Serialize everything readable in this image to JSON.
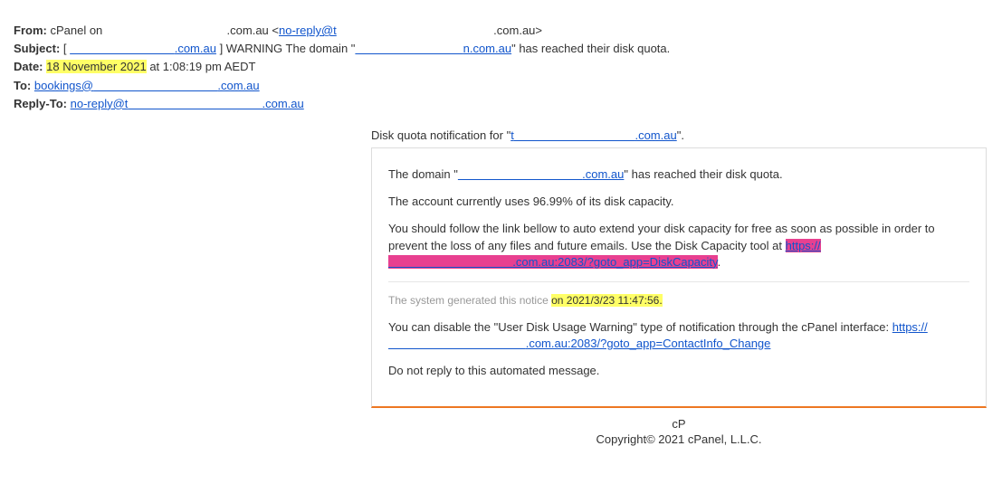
{
  "header": {
    "from_label": "From:",
    "from_value_prefix": " cPanel on ",
    "from_domain1": ".com.au",
    "from_angle_open": " <",
    "from_noreply": "no-reply@t",
    "from_domain2": ".com.au",
    "from_angle_close": ">",
    "subject_label": "Subject:",
    "subject_prefix": " [ ",
    "subject_domain1": ".com.au",
    "subject_mid": " ] WARNING The domain \"",
    "subject_domain2": "n.com.au",
    "subject_suffix": "\" has reached their disk quota.",
    "date_label": "Date:",
    "date_hl": "18 November 2021",
    "date_rest": " at 1:08:19 pm AEDT",
    "to_label": "To:",
    "to_link": "bookings@",
    "to_domain": ".com.au",
    "reply_label": "Reply-To:",
    "reply_link": "no-reply@t",
    "reply_domain": ".com.au"
  },
  "body": {
    "intro_pre": "Disk quota notification for \"",
    "intro_link_pre": "t",
    "intro_link_domain": ".com.au",
    "intro_post": "\".",
    "p1_pre": "The domain \"",
    "p1_link_domain": ".com.au",
    "p1_post": "\" has reached their disk quota.",
    "p2": "The account currently uses 96.99% of its disk capacity.",
    "p3_a": "You should follow the link bellow to auto extend your disk capacity for free as soon as possible in order to prevent the loss of any files and future emails. Use the Disk Capacity tool at ",
    "p3_hl1": "https://",
    "p3_hl2": ".com.au:2083/?goto_app=DiskCapacity",
    "p3_dot": ".",
    "notice_pre": "The system generated this notice ",
    "notice_hl": "on 2021/3/23 11:47:56.",
    "p4_pre": "You can disable the \"User Disk Usage Warning\" type of notification through the cPanel interface: ",
    "p4_link1": "https://",
    "p4_link2": ".com.au:2083/?goto_app=ContactInfo_Change",
    "p5": "Do not reply to this automated message."
  },
  "footer": {
    "brand": "cP",
    "copyright": "Copyright© 2021 cPanel, L.L.C."
  }
}
